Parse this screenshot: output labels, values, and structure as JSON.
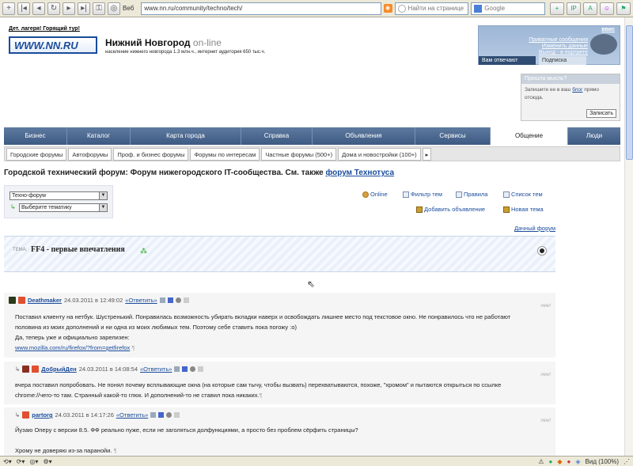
{
  "browser": {
    "search_engine_label": "Веб",
    "url": "www.nn.ru/community/techno/tech/",
    "find_placeholder": "Найти на странице",
    "search_placeholder": "Google",
    "zoom": "Вид (100%)"
  },
  "header": {
    "promo": "Дет. лагеря! Горящий тур!",
    "logo_text": "WWW.NN.RU",
    "logo_small": "нижний новгород",
    "title": "Нижний Новгород",
    "title_online": "on-line",
    "tagline": "население нижнего новгорода 1.3 млн.ч., интернет аудитория 650 тыс.ч.",
    "user": {
      "name": "ввис",
      "private_messages": "Приватные сообщения",
      "change_data": "Изменить данные",
      "logout": "Выход - в портрете",
      "answer_tab": "Вам отвечают",
      "subscribe_tab": "Подписка"
    }
  },
  "idea_box": {
    "title": "Пришла мысль?",
    "text_before": "Запишите ее в ваш ",
    "text_link": "блог",
    "text_after": " прямо отсюда.",
    "button": "Записать"
  },
  "main_nav": [
    {
      "label": "Бизнес",
      "active": false
    },
    {
      "label": "Каталог",
      "active": false
    },
    {
      "label": "Карта города",
      "active": false
    },
    {
      "label": "Справка",
      "active": false
    },
    {
      "label": "Объявления",
      "active": false
    },
    {
      "label": "Сервисы",
      "active": false
    },
    {
      "label": "Общение",
      "active": true
    },
    {
      "label": "Люди",
      "active": false
    }
  ],
  "sub_nav": [
    "Городские форумы",
    "Автофорумы",
    "Проф. и бизнес форумы",
    "Форумы по интересам",
    "Частные форумы (500+)",
    "Дома и новостройки (100+)"
  ],
  "page_title": {
    "text": "Городской технический форум: Форум нижегородского IT-сообщества. См. также",
    "link": "форум Технотуса"
  },
  "filters": {
    "forum_select": "Техно-форум",
    "theme_select": "Выберите тематику"
  },
  "actions": {
    "online": "Online",
    "filter": "Фильтр тем",
    "rules": "Правила",
    "topic_list": "Список тем",
    "add_ad": "Добавить объявление",
    "new_topic": "Новая тема",
    "daily_forum": "Дачный форум"
  },
  "topic": {
    "label": "ТЕМА:",
    "title": "FF4 - первые впечатления"
  },
  "posts": [
    {
      "author": "Deathmaker",
      "date": "24.03.2011 в 12:49:02",
      "reply": "«Ответить»",
      "new": "new!",
      "lines": [
        "Поставил клиенту на нетбук. Шустренький. Понравилась возможность убирать вкладки наверх и освобождать лишнее место под текстовое окно. Не понравилось что не работают",
        "половина из моих дополнений и ни одна из моих любимых тем. Поэтому себе ставить пока погожу :о)",
        "Да, теперь уже и официально зарелизен:"
      ],
      "link": "www.mozilla.com/ru/firefox/?from=getfirefox"
    },
    {
      "author": "ДобрыйДен",
      "date": "24.03.2011 в 14:08:54",
      "reply": "«Ответить»",
      "new": "new!",
      "lines": [
        "вчера поставил попробовать. Не понял почему всплывающие окна (на которые сам тычу, чтобы вызвать) перехватываются, похоже, \"хромом\" и пытаются открыться по ссылке",
        "chrome://чего-то там. Странный какой-то глюк. И дополнений-то не ставил пока никаких."
      ]
    },
    {
      "author": "partorg",
      "date": "24.03.2011 в 14:17:26",
      "reply": "«Ответить»",
      "new": "new!",
      "lines": [
        "Йузаю Оперу с версии 8.5. ФФ реально пуже, если не заголяться долфункциями, а просто без проблем сёрфить страницы?",
        "",
        "Хрому не доверяю из-за паранойи."
      ]
    }
  ]
}
